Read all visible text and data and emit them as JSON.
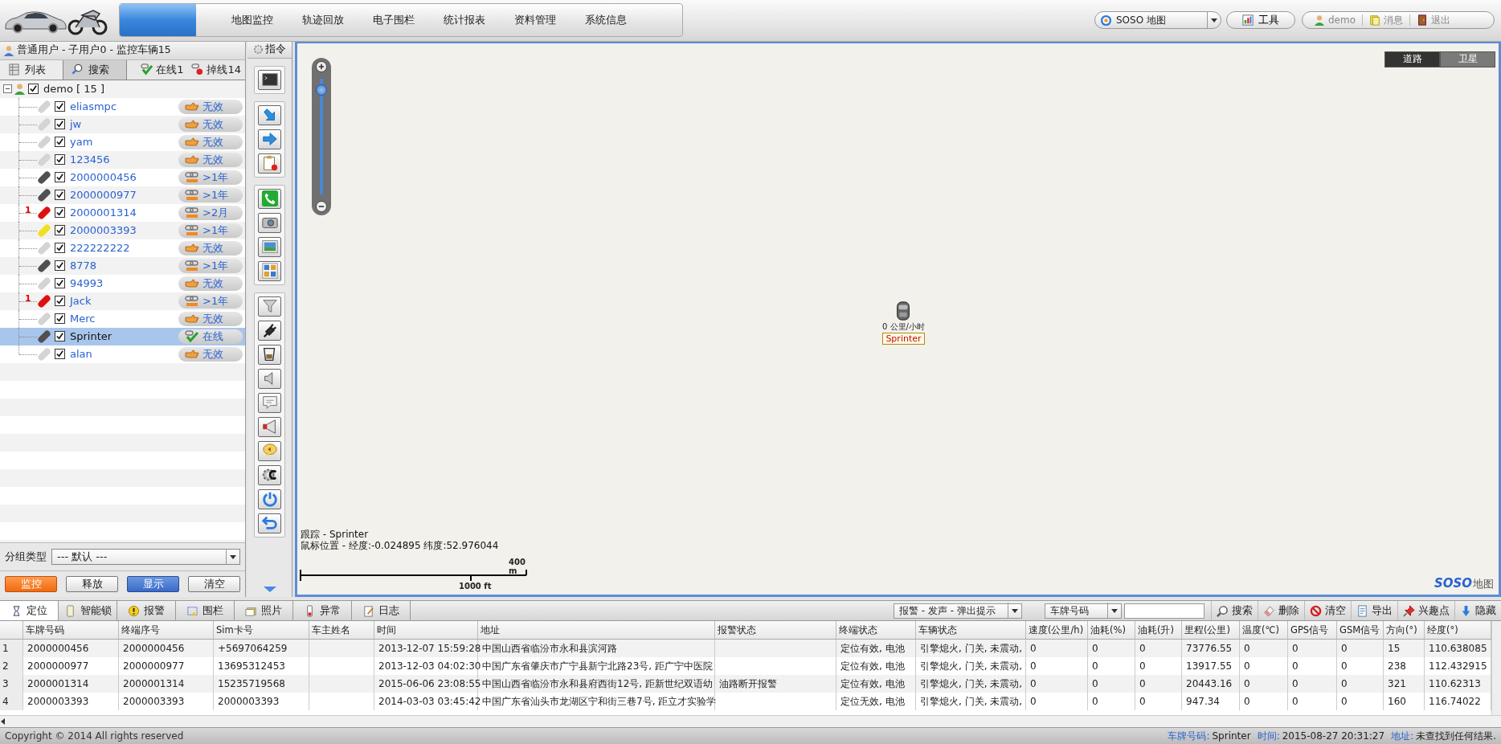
{
  "header": {
    "nav": [
      {
        "label": "地图监控"
      },
      {
        "label": "轨迹回放"
      },
      {
        "label": "电子围栏"
      },
      {
        "label": "统计报表"
      },
      {
        "label": "资料管理"
      },
      {
        "label": "系统信息"
      }
    ],
    "map_select": "SOSO 地图",
    "tools_button": "工具",
    "user": "demo",
    "messages": "消息",
    "logout": "退出"
  },
  "sidebar": {
    "title": "普通用户 - 子用户0 - 监控车辆15",
    "tabs": [
      {
        "label": "列表",
        "selected": true
      },
      {
        "label": "搜索",
        "selected": false
      }
    ],
    "online": "在线1",
    "offline": "掉线14",
    "tree": {
      "label": "demo [ 15 ]",
      "checked": true,
      "expanded": true,
      "children": [
        {
          "name": "eliasmpc",
          "color": "#d4d4d4",
          "checked": true,
          "selected": false,
          "kind": "invalid",
          "status": "无效"
        },
        {
          "name": "jw",
          "color": "#d4d4d4",
          "checked": true,
          "selected": false,
          "kind": "invalid",
          "status": "无效"
        },
        {
          "name": "yam",
          "color": "#d4d4d4",
          "checked": true,
          "selected": false,
          "kind": "invalid",
          "status": "无效"
        },
        {
          "name": "123456",
          "color": "#d4d4d4",
          "checked": true,
          "selected": false,
          "kind": "invalid",
          "status": "无效"
        },
        {
          "name": "2000000456",
          "color": "#505050",
          "checked": true,
          "selected": false,
          "kind": "sms",
          "status": ">1年"
        },
        {
          "name": "2000000977",
          "color": "#505050",
          "checked": true,
          "selected": false,
          "kind": "sms",
          "status": ">1年"
        },
        {
          "name": "2000001314",
          "color": "#e01010",
          "alarm": "1",
          "checked": true,
          "selected": false,
          "kind": "sms",
          "status": ">2月"
        },
        {
          "name": "2000003393",
          "color": "#f0e020",
          "checked": true,
          "selected": false,
          "kind": "sms",
          "status": ">1年"
        },
        {
          "name": "222222222",
          "color": "#d4d4d4",
          "checked": true,
          "selected": false,
          "kind": "invalid",
          "status": "无效"
        },
        {
          "name": "8778",
          "color": "#505050",
          "checked": true,
          "selected": false,
          "kind": "sms",
          "status": ">1年"
        },
        {
          "name": "94993",
          "color": "#d4d4d4",
          "checked": true,
          "selected": false,
          "kind": "invalid",
          "status": "无效"
        },
        {
          "name": "Jack",
          "color": "#e01010",
          "alarm": "1",
          "checked": true,
          "selected": false,
          "kind": "sms",
          "status": ">1年"
        },
        {
          "name": "Merc",
          "color": "#d4d4d4",
          "checked": true,
          "selected": false,
          "kind": "invalid",
          "status": "无效"
        },
        {
          "name": "Sprinter",
          "color": "#505050",
          "checked": true,
          "selected": true,
          "kind": "online",
          "status": "在线"
        },
        {
          "name": "alan",
          "color": "#d4d4d4",
          "checked": true,
          "selected": false,
          "kind": "invalid",
          "status": "无效"
        }
      ]
    },
    "group_label": "分组类型",
    "group_value": "--- 默认 ---",
    "buttons": [
      {
        "label": "监控",
        "kind": "orange"
      },
      {
        "label": "释放",
        "kind": "plain"
      },
      {
        "label": "显示",
        "kind": "blue"
      },
      {
        "label": "清空",
        "kind": "plain"
      }
    ]
  },
  "commands": {
    "title": "指令"
  },
  "map": {
    "layers": [
      {
        "label": "道路",
        "selected": true
      },
      {
        "label": "卫星",
        "selected": false
      }
    ],
    "zoom": {
      "level": 0.9
    },
    "marker": {
      "speed": "0 公里/小时",
      "label": "Sprinter"
    },
    "info": [
      "跟踪 - Sprinter",
      "鼠标位置 - 经度:-0.024895 纬度:52.976044"
    ],
    "scale": {
      "metric": "400 m",
      "imperial": "1000 ft"
    },
    "logo": {
      "brand": "SOSO",
      "suffix": "地图"
    }
  },
  "bottom": {
    "tabs": [
      {
        "label": "定位",
        "selected": true
      },
      {
        "label": "智能锁",
        "selected": false
      },
      {
        "label": "报警",
        "selected": false
      },
      {
        "label": "围栏",
        "selected": false
      },
      {
        "label": "照片",
        "selected": false
      },
      {
        "label": "异常",
        "selected": false
      },
      {
        "label": "日志",
        "selected": false
      }
    ],
    "alarm_mode": "报警 - 发声 - 弹出提示",
    "search_by": "车牌号码",
    "actions": [
      {
        "label": "搜索",
        "kind": "search"
      },
      {
        "label": "删除",
        "kind": "erase"
      },
      {
        "label": "清空",
        "kind": "clear"
      },
      {
        "label": "导出",
        "kind": "export"
      },
      {
        "label": "兴趣点",
        "kind": "pin"
      },
      {
        "label": "隐藏",
        "kind": "hide"
      }
    ]
  },
  "table": {
    "columns": [
      "车牌号码",
      "终端序号",
      "Sim卡号",
      "车主姓名",
      "时间",
      "地址",
      "报警状态",
      "终端状态",
      "车辆状态",
      "速度(公里/h)",
      "油耗(%)",
      "油耗(升)",
      "里程(公里)",
      "温度(℃)",
      "GPS信号",
      "GSM信号",
      "方向(°)",
      "经度(°)"
    ],
    "rows": [
      {
        "number": "1",
        "plate": "2000000456",
        "terminal": "2000000456",
        "sim": "+5697064259",
        "time": "2013-12-07 15:59:28",
        "address": "中国山西省临汾市永和县滨河路",
        "terminal_status": "定位有效, 电池",
        "vehicle_status": "引擎熄火, 门关, 未震动,",
        "speed": "0",
        "fuel_pct": "0",
        "fuel_l": "0",
        "mileage": "73776.55",
        "temperature": "0",
        "gps": "0",
        "gsm": "0",
        "direction": "15",
        "longitude": "110.638085"
      },
      {
        "number": "2",
        "plate": "2000000977",
        "terminal": "2000000977",
        "sim": "13695312453",
        "time": "2013-12-03 04:02:30",
        "address": "中国广东省肇庆市广宁县新宁北路23号, 距广宁中医院",
        "terminal_status": "定位有效, 电池",
        "vehicle_status": "引擎熄火, 门关, 未震动,",
        "speed": "0",
        "fuel_pct": "0",
        "fuel_l": "0",
        "mileage": "13917.55",
        "temperature": "0",
        "gps": "0",
        "gsm": "0",
        "direction": "238",
        "longitude": "112.432915"
      },
      {
        "number": "3",
        "plate": "2000001314",
        "terminal": "2000001314",
        "sim": "15235719568",
        "time": "2015-06-06 23:08:55",
        "address": "中国山西省临汾市永和县府西街12号, 距新世纪双语幼",
        "alarm": "油路断开报警",
        "terminal_status": "定位有效, 电池",
        "vehicle_status": "引擎熄火, 门关, 未震动,",
        "speed": "0",
        "fuel_pct": "0",
        "fuel_l": "0",
        "mileage": "20443.16",
        "temperature": "0",
        "gps": "0",
        "gsm": "0",
        "direction": "321",
        "longitude": "110.62313"
      },
      {
        "number": "4",
        "plate": "2000003393",
        "terminal": "2000003393",
        "sim": "2000003393",
        "time": "2014-03-03 03:45:42",
        "address": "中国广东省汕头市龙湖区宁和街三巷7号, 距立才实验学",
        "terminal_status": "定位无效, 电池",
        "vehicle_status": "引擎熄火, 门关, 未震动,",
        "speed": "0",
        "fuel_pct": "0",
        "fuel_l": "0",
        "mileage": "947.34",
        "temperature": "0",
        "gps": "0",
        "gsm": "0",
        "direction": "160",
        "longitude": "116.74022"
      }
    ]
  },
  "status_bar": {
    "copyright": "Copyright © 2014 All rights reserved",
    "fields": [
      {
        "label": "车牌号码:",
        "value": "Sprinter"
      },
      {
        "label": "时间:",
        "value": "2015-08-27 20:31:27"
      },
      {
        "label": "地址:",
        "value": "未查找到任何结果."
      }
    ]
  }
}
